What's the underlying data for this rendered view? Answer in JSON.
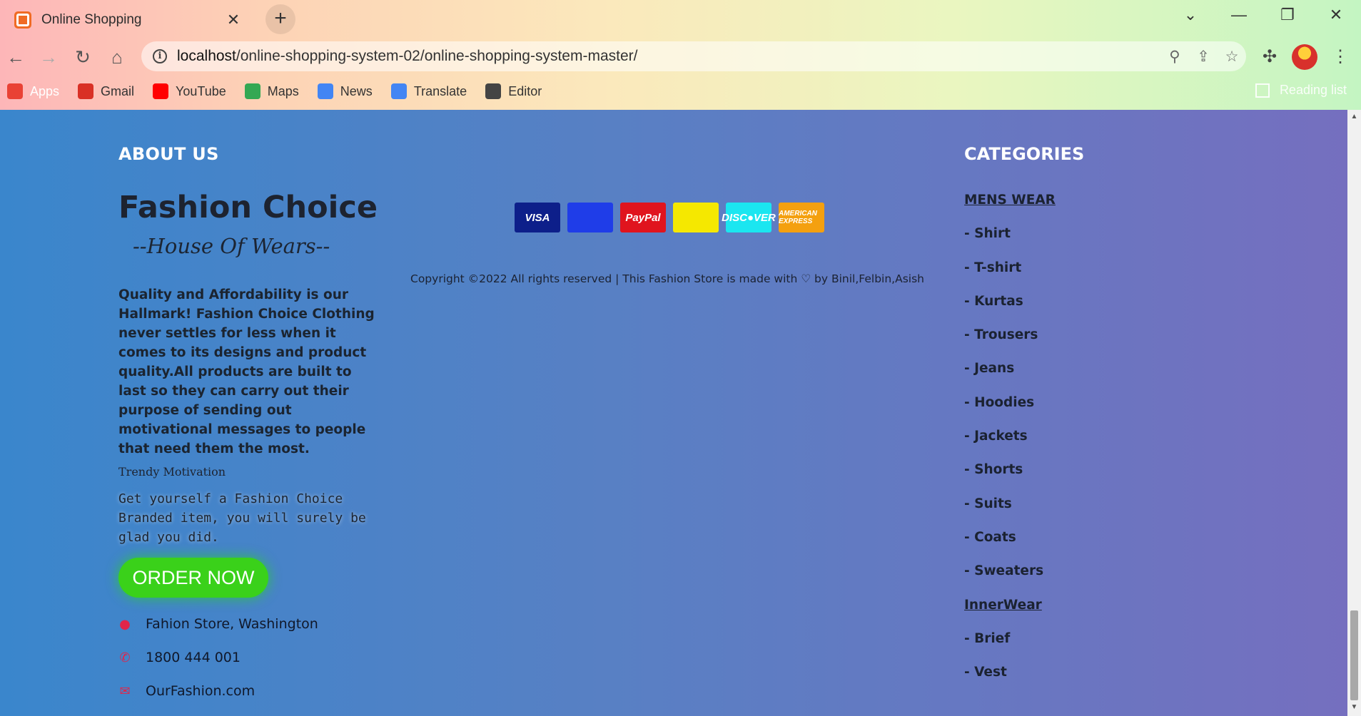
{
  "browser": {
    "tab_title": "Online Shopping",
    "tab_close": "✕",
    "new_tab": "+",
    "url_host": "localhost",
    "url_path": "/online-shopping-system-02/online-shopping-system-master/",
    "bookmarks": [
      {
        "label": "Apps",
        "color": "#e94235"
      },
      {
        "label": "Gmail",
        "color": "#d93025"
      },
      {
        "label": "YouTube",
        "color": "#ff0000"
      },
      {
        "label": "Maps",
        "color": "#34a853"
      },
      {
        "label": "News",
        "color": "#4285f4"
      },
      {
        "label": "Translate",
        "color": "#4285f4"
      },
      {
        "label": "Editor",
        "color": "#444444"
      }
    ],
    "reading_list": "Reading list"
  },
  "footer": {
    "about_title": "ABOUT US",
    "brand": "Fashion Choice",
    "tagline": "--House Of Wears--",
    "about_text": "Quality and Affordability is our Hallmark! Fashion Choice Clothing never settles for less when it comes to its designs and product quality.All products are built to last so they can carry out their purpose of sending out motivational messages to people that need them the most.",
    "motivation_label": "Trendy Motivation",
    "motivation_text": "Get yourself a Fashion Choice Branded item, you will surely be glad you did.",
    "order_button": "ORDER NOW",
    "address": "Fahion Store, Washington",
    "phone": "1800 444 001",
    "website": "OurFashion.com",
    "payment_cards": [
      {
        "label": "VISA",
        "bg": "#0d1f8a",
        "fg": "#ffffff"
      },
      {
        "label": "",
        "bg": "#1f3de8",
        "fg": "#ffffff"
      },
      {
        "label": "PayPal",
        "bg": "#e0141e",
        "fg": "#ffffff"
      },
      {
        "label": "",
        "bg": "#f5e800",
        "fg": "#333333"
      },
      {
        "label": "DISC●VER",
        "bg": "#1be6f0",
        "fg": "#ffffff"
      },
      {
        "label": "AMERICAN EXPRESS",
        "bg": "#f4a00f",
        "fg": "#ffffff"
      }
    ],
    "copyright": "Copyright ©2022 All rights reserved | This Fashion Store is made with ♡ by Binil,Felbin,Asish",
    "categories_title": "CATEGORIES",
    "categories": [
      {
        "label": "MENS WEAR",
        "heading": true
      },
      {
        "label": "- Shirt"
      },
      {
        "label": "- T-shirt"
      },
      {
        "label": "- Kurtas"
      },
      {
        "label": "- Trousers"
      },
      {
        "label": "- Jeans"
      },
      {
        "label": "- Hoodies"
      },
      {
        "label": "- Jackets"
      },
      {
        "label": "- Shorts"
      },
      {
        "label": "- Suits"
      },
      {
        "label": "- Coats"
      },
      {
        "label": "- Sweaters"
      },
      {
        "label": "InnerWear",
        "heading": true
      },
      {
        "label": "- Brief"
      },
      {
        "label": "- Vest"
      }
    ]
  }
}
